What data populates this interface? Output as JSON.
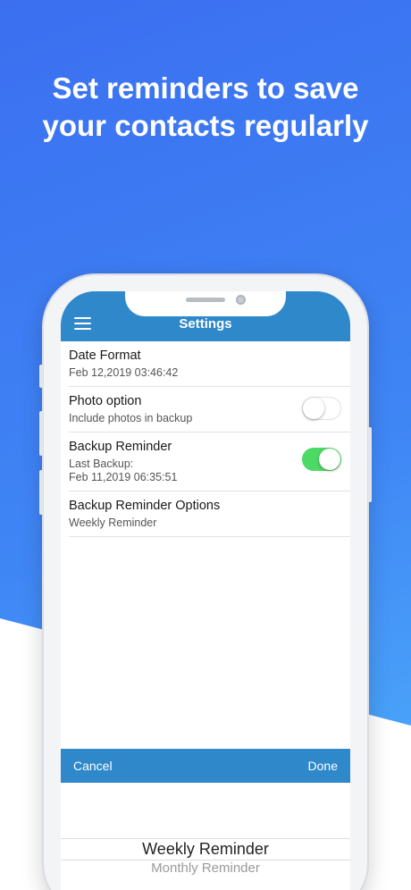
{
  "headline": "Set reminders to save\nyour contacts regularly",
  "nav": {
    "title": "Settings",
    "menu_icon": "hamburger-menu-icon"
  },
  "settings": [
    {
      "title": "Date Format",
      "subtitle": "Feb 12,2019 03:46:42"
    },
    {
      "title": "Photo option",
      "subtitle": "Include photos in backup",
      "toggle": false
    },
    {
      "title": "Backup Reminder",
      "subtitle": "Last Backup:\nFeb 11,2019 06:35:51",
      "toggle": true
    },
    {
      "title": "Backup Reminder Options",
      "subtitle": "Weekly Reminder"
    }
  ],
  "picker": {
    "cancel_label": "Cancel",
    "done_label": "Done",
    "options": [
      "Weekly Reminder",
      "Monthly Reminder"
    ],
    "selected": "Weekly Reminder"
  },
  "colors": {
    "navbar": "#2f88c9",
    "toggle_on": "#4cd964",
    "gradient_start": "#3b6ff0",
    "gradient_end": "#4fb0fb"
  }
}
